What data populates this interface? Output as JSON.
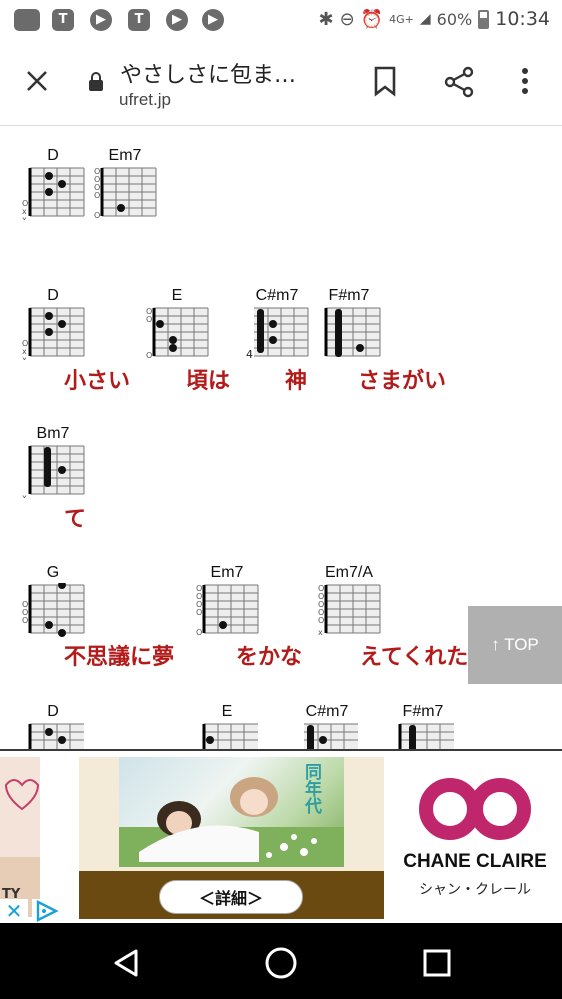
{
  "status_bar": {
    "battery": "60%",
    "network": "4G+",
    "time": "10:34"
  },
  "toolbar": {
    "title": "やさしさに包ま…",
    "url": "ufret.jp"
  },
  "chords": {
    "row1": [
      "D",
      "Em7"
    ],
    "row2": [
      "D",
      "E",
      "C#m7",
      "F#m7"
    ],
    "row3": [
      "Bm7"
    ],
    "row4": [
      "G",
      "Em7",
      "Em7/A"
    ],
    "row5": [
      "D",
      "E",
      "C#m7",
      "F#m7"
    ],
    "fret_marker": "4"
  },
  "lyrics": {
    "row2": [
      "小さい",
      "頃は",
      "神",
      "さまがい"
    ],
    "row3": [
      "て"
    ],
    "row4": [
      "不思議に夢",
      "をかな",
      "えてくれた"
    ]
  },
  "top_button": "↑ TOP",
  "ad": {
    "left_text": "TY",
    "photo_text": "同年代",
    "detail_button": "＜詳細＞",
    "brand": "CHANE CLAIRE",
    "brand_kana": "シャン・クレール",
    "close": "✕"
  },
  "colors": {
    "lyric": "#b31b1b",
    "nav_bg": "#000000",
    "brand_logo": "#c0266c"
  }
}
